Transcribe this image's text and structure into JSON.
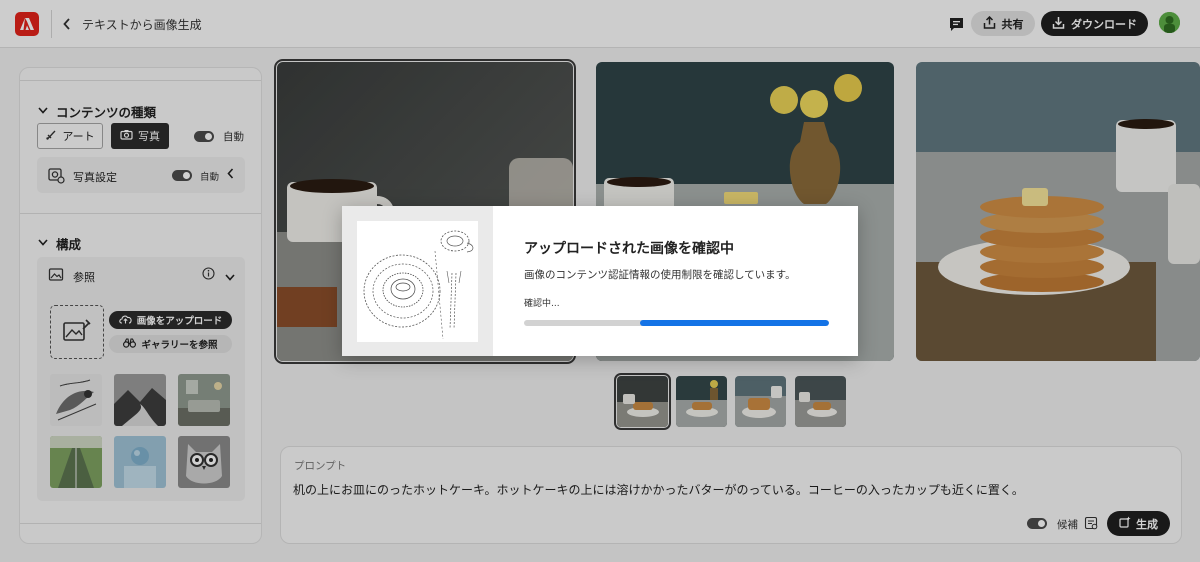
{
  "header": {
    "title": "テキストから画像生成",
    "share_label": "共有",
    "download_label": "ダウンロード"
  },
  "sidebar": {
    "content_type": {
      "heading": "コンテンツの種類",
      "art_label": "アート",
      "photo_label": "写真",
      "auto_label": "自動"
    },
    "photo_settings": {
      "label": "写真設定",
      "auto_label": "自動"
    },
    "composition": {
      "heading": "構成",
      "reference_label": "参照",
      "upload_label": "画像をアップロード",
      "gallery_label": "ギャラリーを参照"
    }
  },
  "prompt": {
    "label": "プロンプト",
    "text": "机の上にお皿にのったホットケーキ。ホットケーキの上には溶けかかったバターがのっている。コーヒーの入ったカップも近くに置く。",
    "suggest_label": "候補",
    "generate_label": "生成"
  },
  "modal": {
    "title": "アップロードされた画像を確認中",
    "description": "画像のコンテンツ認証情報の使用制限を確認しています。",
    "status": "確認中...",
    "progress": {
      "start_fraction": 0.38,
      "end_fraction": 1.0
    }
  },
  "colors": {
    "brand": "#e2231a",
    "accent": "#1473e6",
    "dark_button": "#1f1f1f"
  },
  "icons": [
    "adobe-logo-icon",
    "back-chevron-icon",
    "comment-icon",
    "share-icon",
    "download-icon",
    "art-brush-icon",
    "camera-icon",
    "photo-settings-icon",
    "info-icon",
    "upload-cloud-icon",
    "binoculars-icon",
    "image-add-icon",
    "sparkle-generate-icon"
  ]
}
